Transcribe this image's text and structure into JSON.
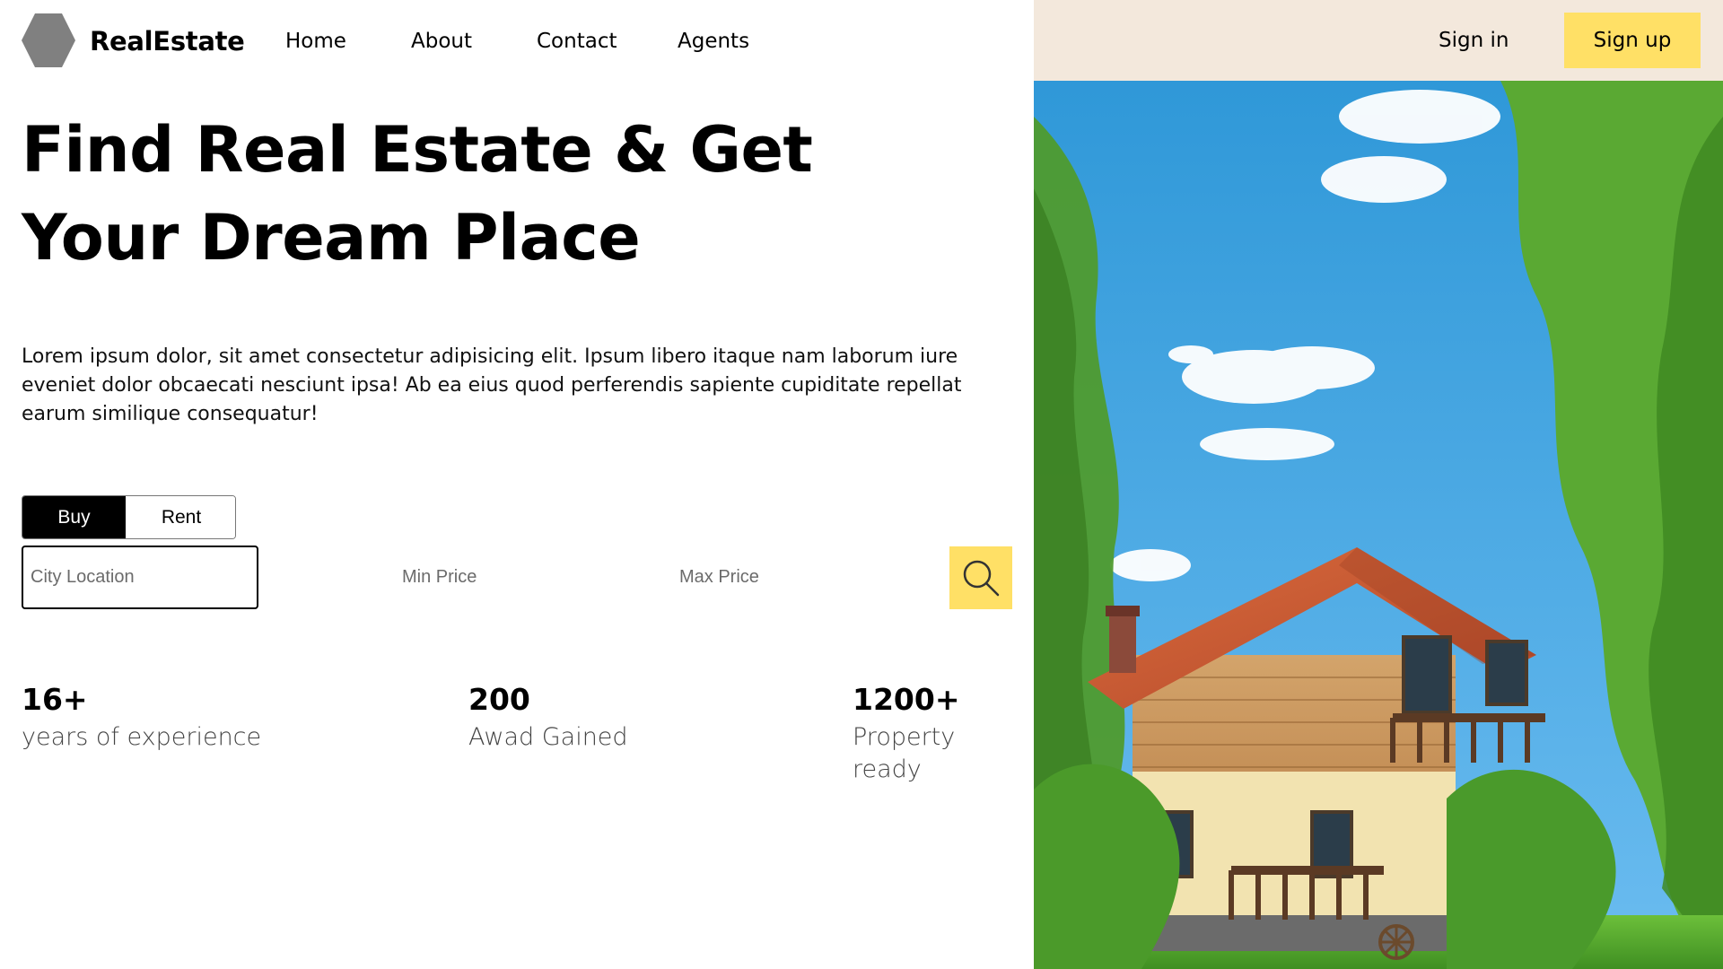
{
  "brand": "RealEstate",
  "nav": {
    "items": [
      "Home",
      "About",
      "Contact",
      "Agents"
    ]
  },
  "auth": {
    "signin_label": "Sign in",
    "signup_label": "Sign up"
  },
  "hero": {
    "title": "Find Real Estate & Get Your Dream Place",
    "lead": "Lorem ipsum dolor, sit amet consectetur adipisicing elit. Ipsum libero itaque nam laborum iure eveniet dolor obcaecati nesciunt ipsa! Ab ea eius quod perferendis sapiente cupiditate repellat earum similique consequatur!"
  },
  "search": {
    "toggle": {
      "buy": "Buy",
      "rent": "Rent",
      "selected": "Buy"
    },
    "city_placeholder": "City Location",
    "min_placeholder": "Min Price",
    "max_placeholder": "Max Price",
    "button_icon": "search-icon"
  },
  "stats": [
    {
      "number": "16+",
      "label": "years of experience"
    },
    {
      "number": "200",
      "label": "Awad Gained"
    },
    {
      "number": "1200+",
      "label": "Property ready"
    }
  ],
  "colors": {
    "accent": "#ffe066",
    "right_header_bg": "#f3e8dc",
    "selected_tab_bg": "#000000",
    "logo_gray": "#808080"
  }
}
